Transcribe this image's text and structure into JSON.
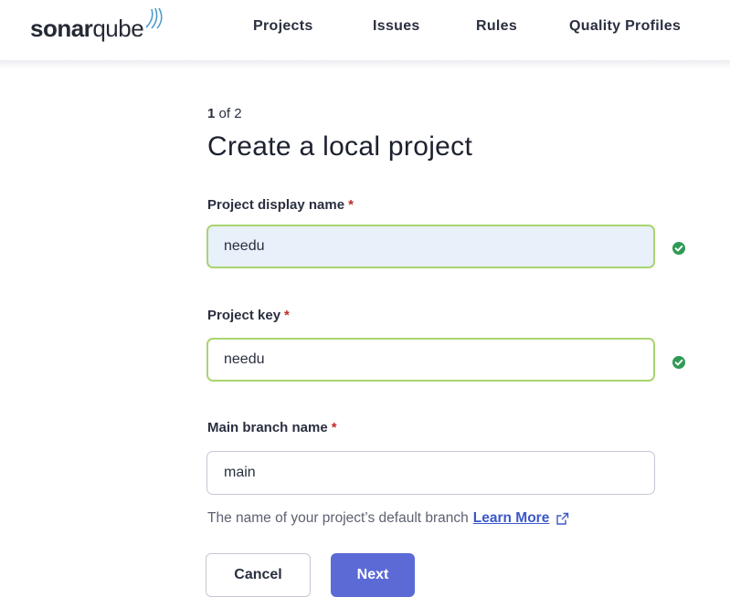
{
  "header": {
    "logo": {
      "bold": "sonar",
      "light": "qube",
      "icon": "sonar-waves-icon"
    },
    "nav": [
      "Projects",
      "Issues",
      "Rules",
      "Quality Profiles"
    ]
  },
  "form": {
    "step": {
      "current": "1",
      "rest": " of 2"
    },
    "title": "Create a local project",
    "fields": [
      {
        "label": "Project display name",
        "required_mark": "*",
        "value": "needu",
        "valid": true
      },
      {
        "label": "Project key",
        "required_mark": "*",
        "value": "needu",
        "valid": true
      },
      {
        "label": "Main branch name",
        "required_mark": "*",
        "value": "main",
        "valid": null
      }
    ],
    "help": {
      "text": "The name of your project’s default branch",
      "link": "Learn More",
      "link_icon": "external-link-icon"
    },
    "buttons": {
      "cancel": "Cancel",
      "next": "Next"
    }
  },
  "colors": {
    "accent": "#5c6ad6",
    "valid_border": "#a8d571",
    "valid_check": "#2e9a54",
    "required": "#c12b2b",
    "link": "#3c58c9"
  }
}
